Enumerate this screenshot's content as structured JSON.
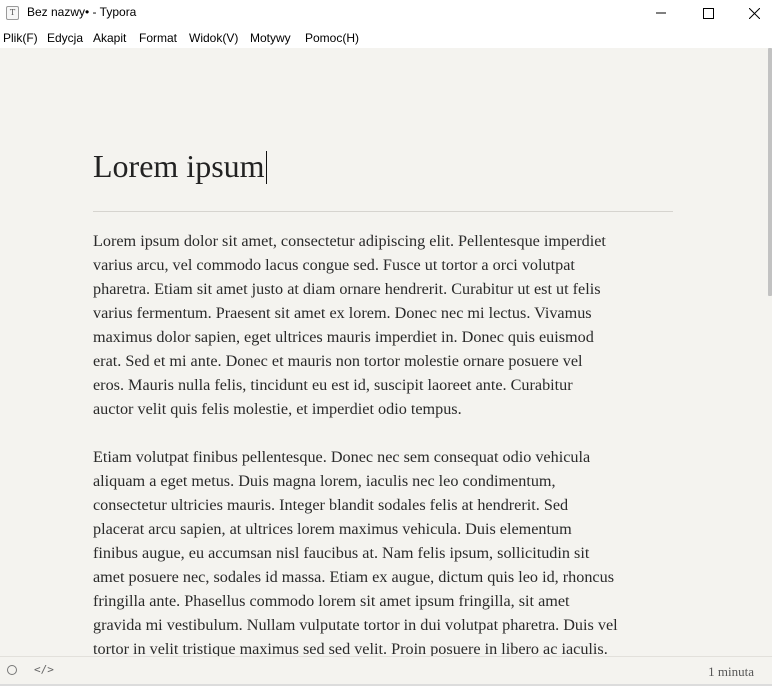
{
  "window": {
    "app_icon_letter": "T",
    "title": "Bez nazwy• - Typora"
  },
  "menu": {
    "items": [
      "Plik(F)",
      "Edycja",
      "Akapit",
      "Format",
      "Widok(V)",
      "Motywy",
      "Pomoc(H)"
    ]
  },
  "document": {
    "heading": "Lorem ipsum",
    "paragraph1": [
      "Lorem ipsum dolor sit amet, consectetur adipiscing elit. Pellentesque  imperdiet",
      "varius arcu, vel commodo lacus congue sed. Fusce ut tortor a  orci volutpat",
      "pharetra. Etiam sit amet justo at diam ornare hendrerit.  Curabitur ut est ut felis",
      "varius fermentum. Praesent sit amet ex lorem.  Donec nec mi lectus. Vivamus",
      "maximus dolor sapien, eget ultrices mauris  imperdiet in. Donec quis euismod",
      "erat. Sed et mi ante. Donec et mauris  non tortor molestie ornare posuere vel",
      "eros. Mauris nulla felis,  tincidunt eu est id, suscipit laoreet ante. Curabitur",
      "auctor velit quis  felis molestie, et imperdiet odio tempus."
    ],
    "paragraph2": [
      "Etiam volutpat finibus pellentesque. Donec nec sem consequat odio  vehicula",
      "aliquam a eget metus. Duis magna lorem, iaculis nec leo  condimentum,",
      "consectetur ultricies mauris. Integer blandit sodales felis at hendrerit. Sed",
      "placerat arcu sapien, at ultrices lorem maximus  vehicula. Duis elementum",
      "finibus augue, eu accumsan nisl faucibus at.  Nam felis ipsum, sollicitudin sit",
      "amet posuere nec, sodales id massa.  Etiam ex augue, dictum quis leo id, rhoncus",
      "fringilla ante. Phasellus  commodo lorem sit amet ipsum fringilla, sit amet",
      "gravida mi vestibulum.  Nullam vulputate tortor in dui volutpat pharetra. Duis vel",
      "tortor in  velit tristique maximus sed sed velit. Proin posuere in libero ac  iaculis."
    ]
  },
  "statusbar": {
    "source_code_toggle": "</>",
    "word_count_label": "1 minuta"
  },
  "icons": {
    "minimize": "minimize-icon",
    "maximize": "maximize-icon",
    "close": "close-icon",
    "sidebar_toggle": "circle-outline-icon",
    "source_mode": "code-brackets-icon"
  }
}
